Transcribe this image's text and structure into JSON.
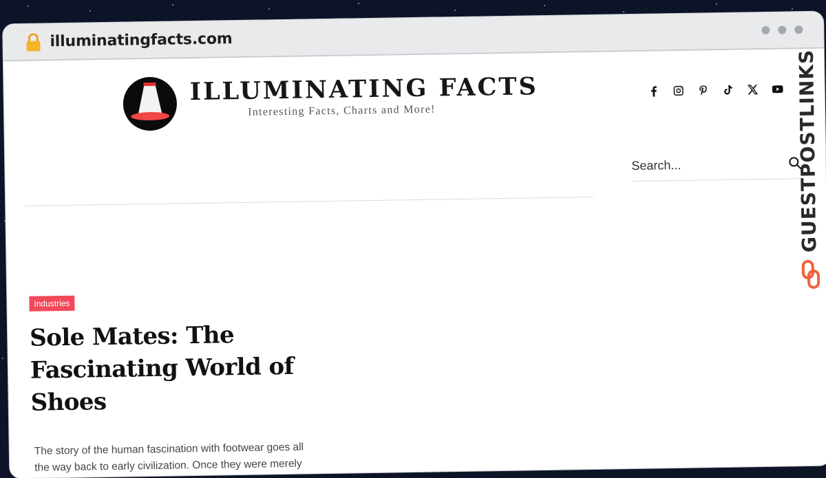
{
  "browser": {
    "url": "illuminatingfacts.com"
  },
  "header": {
    "brand_name": "ILLUMINATING FACTS",
    "tagline": "Interesting Facts, Charts and More!"
  },
  "social_icons": [
    "facebook-icon",
    "instagram-icon",
    "pinterest-icon",
    "tiktok-icon",
    "x-icon",
    "youtube-icon"
  ],
  "search": {
    "placeholder": "Search..."
  },
  "article": {
    "category": "Industries",
    "title": "Sole Mates: The Fascinating World of Shoes",
    "excerpt": "The story of the human fascination with footwear goes all the way back to early civilization. Once they were merely"
  },
  "watermark": {
    "text": "GUESTPOSTLINKS"
  },
  "colors": {
    "accent": "#f2495a",
    "background": "#0d1428",
    "watermark_orange": "#f0623a"
  }
}
